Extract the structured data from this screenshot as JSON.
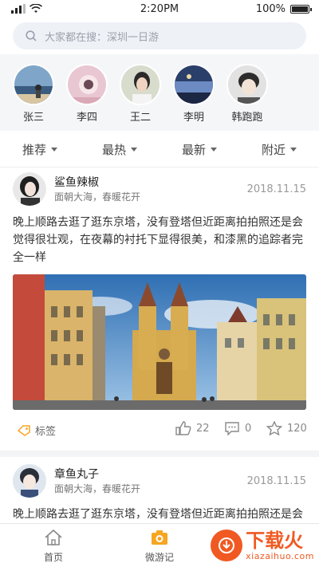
{
  "status": {
    "time": "2:20PM",
    "battery": "100%"
  },
  "search": {
    "placeholder": "大家都在搜：深圳一日游"
  },
  "users": [
    {
      "name": "张三"
    },
    {
      "name": "李四"
    },
    {
      "name": "王二"
    },
    {
      "name": "李明"
    },
    {
      "name": "韩跑跑"
    }
  ],
  "tabs": [
    {
      "label": "推荐"
    },
    {
      "label": "最热"
    },
    {
      "label": "最新"
    },
    {
      "label": "附近"
    }
  ],
  "posts": [
    {
      "author": "鲨鱼辣椒",
      "subtitle": "面朝大海，春暖花开",
      "date": "2018.11.15",
      "text": "晚上顺路去逛了逛东京塔，没有登塔但近距离拍拍照还是会觉得很壮观，在夜幕的衬托下显得很美，和漆黑的追踪者完全一样",
      "tag": "标签",
      "likes": "22",
      "comments": "0",
      "favorites": "120"
    },
    {
      "author": "章鱼丸子",
      "subtitle": "面朝大海，春暖花开",
      "date": "2018.11.15",
      "text": "晚上顺路去逛了逛东京塔，没有登塔但近距离拍拍照还是会"
    }
  ],
  "nav": [
    {
      "label": "首页"
    },
    {
      "label": "微游记"
    }
  ],
  "watermark": {
    "title": "下载火",
    "domain": "xiazaihuo.com"
  },
  "colors": {
    "accent": "#f05a22",
    "search_bg": "#eef1f6",
    "nav_active": "#f5a623"
  }
}
